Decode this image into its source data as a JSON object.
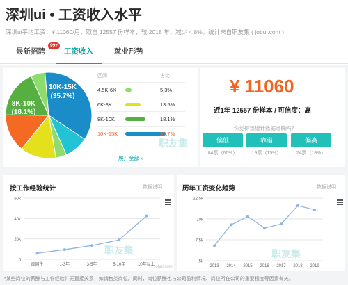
{
  "header": {
    "title": "深圳ui • 工资收入水平",
    "subtitle": "深圳ui平均工资：¥ 11060/月，取自 12557 份样本，较 2018 年，减少 4.8%。统计来自职友集 ( jobui.com )"
  },
  "tabs": [
    {
      "label": "最新招聘",
      "badge": "99+",
      "active": false
    },
    {
      "label": "工资收入",
      "active": true
    },
    {
      "label": "就业形势",
      "active": false
    }
  ],
  "distribution": {
    "col_range": "区间",
    "col_share": "占比",
    "rows": [
      {
        "range": "4.5K-6K",
        "share": "5.3%",
        "value": 5.3,
        "color": "#8fdc6e",
        "highlight": false
      },
      {
        "range": "6K-8K",
        "share": "13.5%",
        "value": 13.5,
        "color": "#e5e01c",
        "highlight": false
      },
      {
        "range": "8K-10K",
        "share": "18.1%",
        "value": 18.1,
        "color": "#55b041",
        "highlight": false
      },
      {
        "range": "10K-15K",
        "share": "35.7%",
        "value": 35.7,
        "color": "#1a8cc8",
        "highlight": true
      }
    ],
    "expand_label": "展开全部 »"
  },
  "pie": {
    "label_big": "10K-15K",
    "label_big_pct": "(35.7%)",
    "label_mid": "8K-10K",
    "label_mid_pct": "(18.1%)",
    "slices": [
      {
        "name": "10K-15K",
        "value": 35.7,
        "color": "#1a8cc8"
      },
      {
        "name": "",
        "value": 9,
        "color": "#22c3d4"
      },
      {
        "name": "",
        "value": 4,
        "color": "#8fdc6e"
      },
      {
        "name": "6K-8K",
        "value": 13.5,
        "color": "#e5e01c"
      },
      {
        "name": "",
        "value": 14.4,
        "color": "#f46a22"
      },
      {
        "name": "8K-10K",
        "value": 18.1,
        "color": "#55b041"
      },
      {
        "name": "4.5K-6K",
        "value": 5.3,
        "color": "#8fdc6e"
      }
    ]
  },
  "summary": {
    "salary": "¥ 11060",
    "stat_line": "近1年 12557 份样本 / 可信度：高",
    "vote_question": "你觉得该统计数据准确吗？",
    "votes": [
      {
        "label": "偏低",
        "count": "84票（66%）"
      },
      {
        "label": "靠谱",
        "count": "19票（15%）"
      },
      {
        "label": "偏高",
        "count": "24票（19%）"
      }
    ]
  },
  "watermark": "职友集",
  "url_mark": "jobui.com",
  "charts": [
    {
      "title": "按工作经验统计",
      "link": "数据说明",
      "chart_data": {
        "type": "line",
        "categories": [
          "应届生",
          "1-3年",
          "3-5年",
          "5-10年",
          "10年以上"
        ],
        "values": [
          6000,
          9500,
          13500,
          19000,
          42500
        ],
        "yticks": [
          "0",
          "20k",
          "40k",
          "60k"
        ],
        "ylim": [
          0,
          60000
        ],
        "color": "#8fb5e0"
      }
    },
    {
      "title": "历年工资变化趋势",
      "link": "数据说明",
      "chart_data": {
        "type": "line",
        "categories": [
          "2013",
          "2014",
          "2015",
          "2016",
          "2017",
          "2018",
          "2019"
        ],
        "values": [
          6800,
          9300,
          10300,
          8900,
          9400,
          11600,
          11100
        ],
        "yticks": [
          "5k",
          "7.5k",
          "10k",
          "12.5k"
        ],
        "ylim": [
          5000,
          12500
        ],
        "color": "#8fb5e0"
      }
    }
  ],
  "footer": "*某些岗位的薪酬与工作经验并无直接关系，如销售类岗位。同时，岗位薪酬也与公司盈利情况、岗位所在公司的重要程度等因素有关。"
}
